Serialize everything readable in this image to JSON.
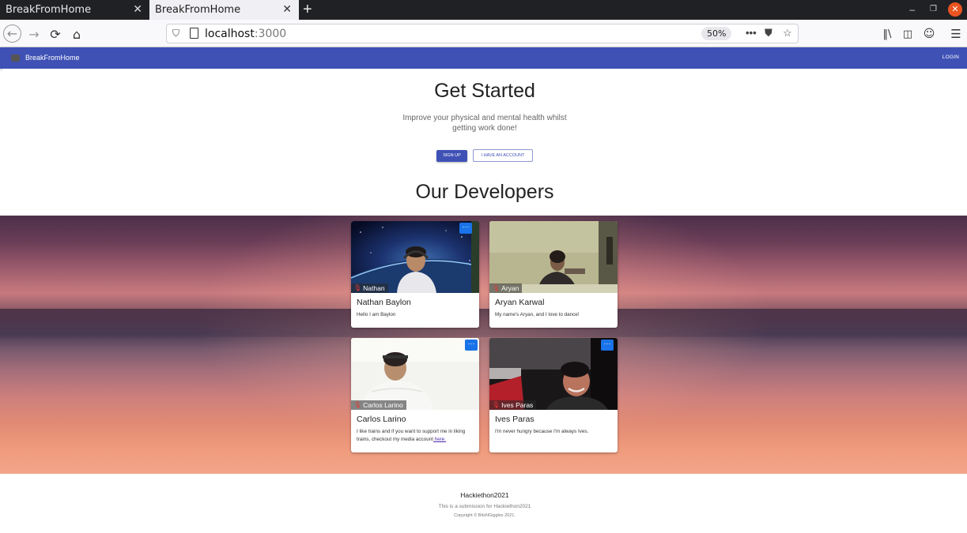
{
  "browser": {
    "tabs": [
      {
        "label": "BreakFromHome",
        "active": false
      },
      {
        "label": "BreakFromHome",
        "active": true
      }
    ],
    "new_tab_label": "+",
    "url_host": "localhost",
    "url_port": ":3000",
    "zoom": "50%"
  },
  "appbar": {
    "title": "BreakFromHome",
    "login_label": "LOGIN"
  },
  "hero": {
    "title": "Get Started",
    "subtitle": "Improve your physical and mental health whilst getting work done!",
    "signup_label": "SIGN UP",
    "account_label": "I HAVE AN ACCOUNT",
    "developers_title": "Our Developers"
  },
  "developers": [
    {
      "name": "Nathan Baylon",
      "video_label": "Nathan",
      "description": "Hello I am Baylon"
    },
    {
      "name": "Aryan Karwal",
      "video_label": "Aryan",
      "description": "My name's Aryan, and I love to dance!"
    },
    {
      "name": "Carlos Larino",
      "video_label": "Carlos Larino",
      "description": "I like trains and if you want to support me in liking trains, checkout my media account",
      "link_text": " here."
    },
    {
      "name": "Ives Paras",
      "video_label": "Ives Paras",
      "description": "I'm never hungry because I'm always Ives."
    }
  ],
  "footer": {
    "title": "Hackiethon2021",
    "subtitle": "This is a submission for Hackiethon2021",
    "copyright": "Copyright © BitsNGiggles 2021."
  },
  "colors": {
    "appbar": "#3f51b5",
    "more_button": "#1a73e8",
    "window_close": "#e95420"
  }
}
